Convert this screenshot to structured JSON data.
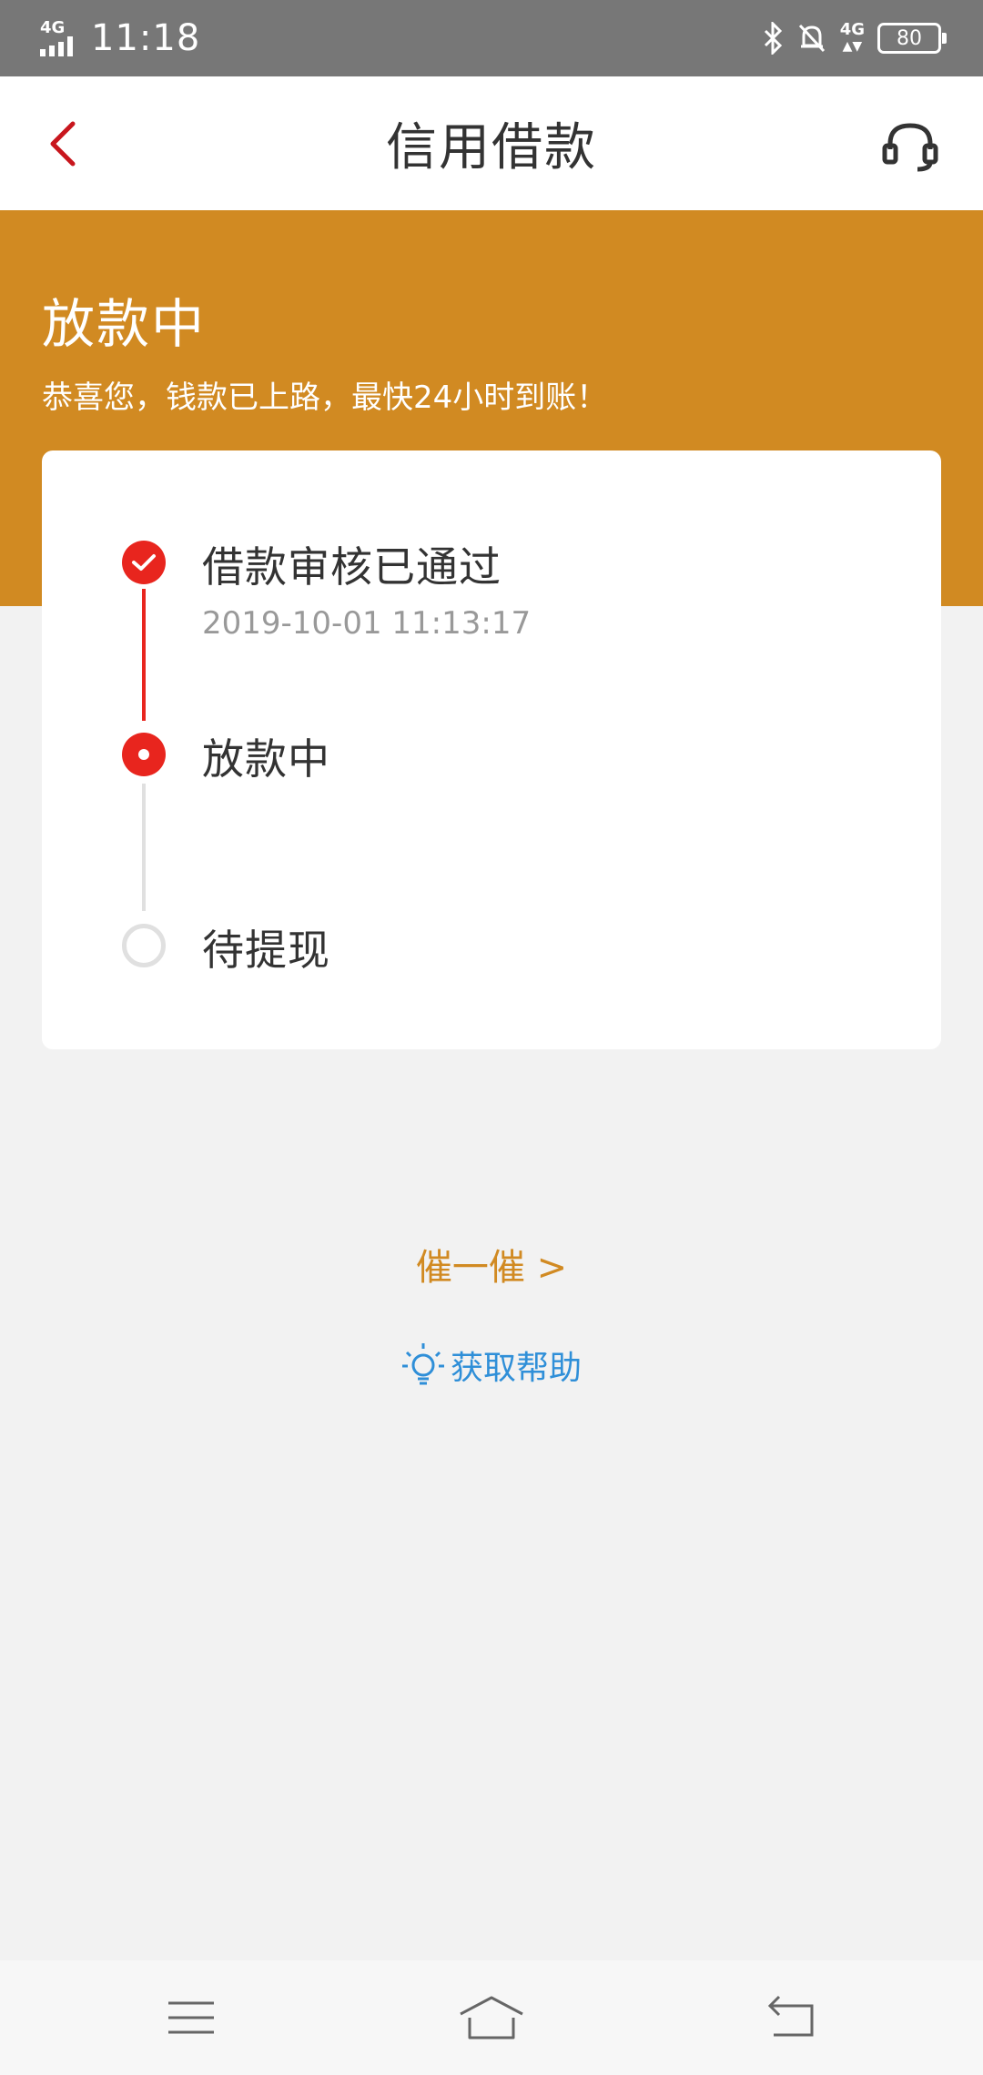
{
  "status_bar": {
    "signal": "4G",
    "time": "11:18",
    "network": "4G",
    "battery": "80"
  },
  "nav": {
    "title": "信用借款",
    "back_icon": "chevron-left-icon",
    "service_icon": "headset-icon"
  },
  "banner": {
    "title": "放款中",
    "subtitle": "恭喜您，钱款已上路，最快24小时到账！"
  },
  "steps": [
    {
      "label": "借款审核已通过",
      "time": "2019-10-01 11:13:17",
      "state": "done"
    },
    {
      "label": "放款中",
      "state": "active"
    },
    {
      "label": "待提现",
      "state": "pending"
    }
  ],
  "actions": {
    "urge": "催一催 >",
    "help": "获取帮助"
  },
  "colors": {
    "accent_orange": "#d18a22",
    "progress_red": "#e8251e",
    "link_blue": "#2f8fd8"
  }
}
